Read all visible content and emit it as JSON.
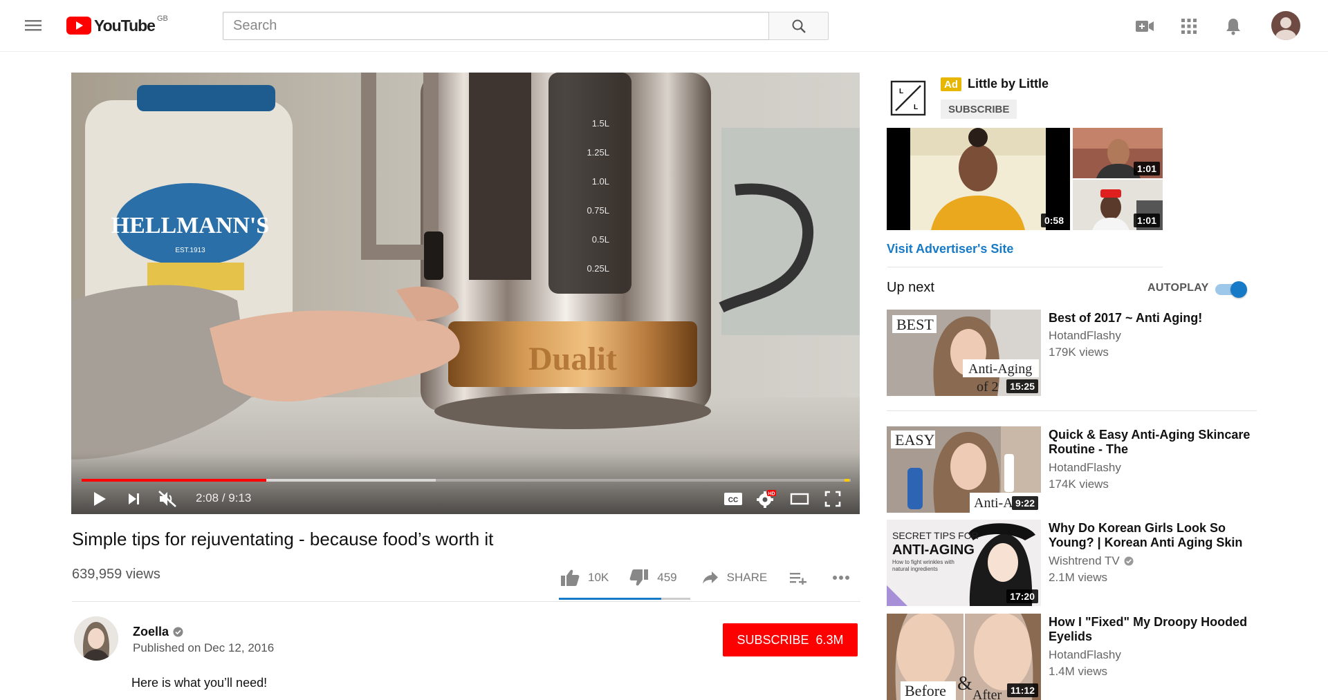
{
  "masthead": {
    "logo_text": "YouTube",
    "region": "GB",
    "search_placeholder": "Search"
  },
  "player": {
    "progress": {
      "played_fraction": 0.24,
      "loaded_fraction": 0.46
    },
    "time_current": "2:08",
    "time_separator": " / ",
    "time_total": "9:13",
    "scene_text": {
      "jar_brand": "HELLMANN'S",
      "jar_est": "EST.1913",
      "kettle_brand": "Dualit",
      "scale": [
        "1.5L",
        "1.25L",
        "1.0L",
        "0.75L",
        "0.5L",
        "0.25L"
      ]
    }
  },
  "video": {
    "title": "Simple tips for rejuventating - because food’s worth it",
    "views": "639,959 views",
    "likes": "10K",
    "dislikes": "459",
    "like_fraction": 0.78,
    "share_label": "SHARE"
  },
  "owner": {
    "name": "Zoella",
    "published": "Published on Dec 12, 2016",
    "subscribe_label": "SUBSCRIBE",
    "subscriber_count": "6.3M"
  },
  "description": {
    "first_line": "Here is what you’ll need!"
  },
  "ad": {
    "badge": "Ad",
    "title": "Little by Little",
    "subscribe_label": "SUBSCRIBE",
    "main_duration": "0:58",
    "side_durations": [
      "1:01",
      "1:01"
    ],
    "visit_label": "Visit Advertiser's Site"
  },
  "upnext": {
    "label": "Up next",
    "autoplay_label": "AUTOPLAY",
    "autoplay_on": true
  },
  "recommendations": [
    {
      "title": "Best of 2017 ~ Anti Aging!",
      "channel": "HotandFlashy",
      "verified": false,
      "views": "179K views",
      "duration": "15:25",
      "thumb_text": [
        "BEST",
        "Anti-Aging",
        "of 2"
      ]
    },
    {
      "title": "Quick & Easy Anti-Aging Skincare Routine - The",
      "channel": "HotandFlashy",
      "verified": false,
      "views": "174K views",
      "duration": "9:22",
      "thumb_text": [
        "EASY",
        "Anti-A"
      ]
    },
    {
      "title": "Why Do Korean Girls Look So Young? | Korean Anti Aging Skin",
      "channel": "Wishtrend TV",
      "verified": true,
      "views": "2.1M views",
      "duration": "17:20",
      "thumb_text": [
        "SECRET TIPS FOR",
        "ANTI-AGING",
        "How to fight wrinkles with",
        "natural ingredients"
      ]
    },
    {
      "title": "How I \"Fixed\" My Droopy Hooded Eyelids",
      "channel": "HotandFlashy",
      "verified": false,
      "views": "1.4M views",
      "duration": "11:12",
      "thumb_text": [
        "Before",
        "&",
        "After"
      ]
    }
  ],
  "colors": {
    "brand_red": "#ff0000",
    "link_blue": "#167ac6",
    "ad_yellow": "#e6b600"
  }
}
